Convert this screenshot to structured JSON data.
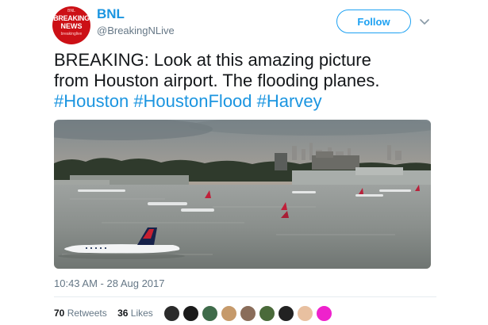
{
  "author": {
    "name": "BNL",
    "handle": "@BreakingNLive",
    "avatar_text": {
      "top": "BNL",
      "line1": "BREAKING",
      "line2": "NEWS",
      "line3": "breakinglive"
    }
  },
  "follow_button": {
    "label": "Follow"
  },
  "tweet": {
    "line1": "BREAKING: Look at this amazing picture",
    "line2": "from Houston airport. The flooding planes.",
    "hashtags": [
      "#Houston",
      "#HoustonFlood",
      "#Harvey"
    ]
  },
  "timestamp": "10:43 AM - 28 Aug 2017",
  "stats": {
    "retweets_count": "70",
    "retweets_label": "Retweets",
    "likes_count": "36",
    "likes_label": "Likes"
  },
  "likers": [
    {
      "color": "#2b2b2b"
    },
    {
      "color": "#1a1a1a"
    },
    {
      "color": "#3f6b4a"
    },
    {
      "color": "#c69a6b"
    },
    {
      "color": "#8a6d5a"
    },
    {
      "color": "#4a6a3a"
    },
    {
      "color": "#222222"
    },
    {
      "color": "#e8c0a0"
    },
    {
      "color": "#ee22cc"
    }
  ],
  "colors": {
    "link": "#1b95e0",
    "follow": "#1da1f2",
    "muted": "#657786",
    "brand_red": "#cc1016"
  },
  "icons": {
    "caret": "chevron-down-icon"
  }
}
